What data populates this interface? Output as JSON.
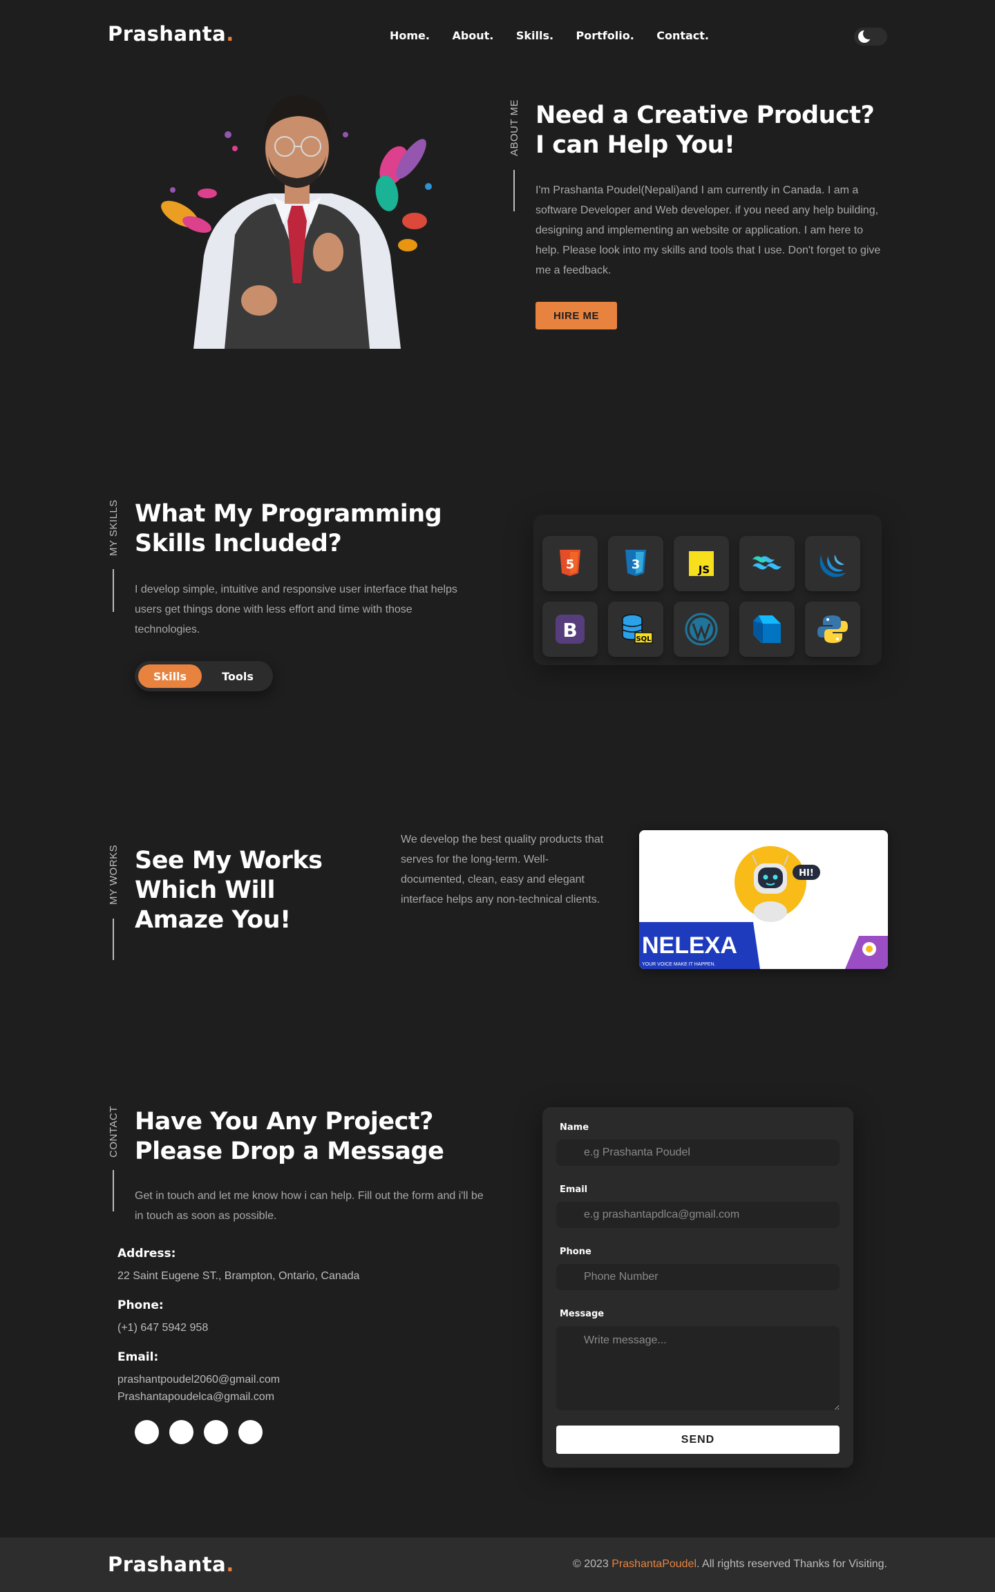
{
  "header": {
    "logo": "Prashanta",
    "logo_dot": ".",
    "nav": [
      "Home.",
      "About.",
      "Skills.",
      "Portfolio.",
      "Contact."
    ],
    "theme_icon": "moon-icon"
  },
  "about": {
    "label": "ABOUT ME",
    "title_line1": "Need a Creative Product?",
    "title_line2": "I can Help You!",
    "description": "I'm Prashanta Poudel(Nepali)and I am currently in Canada. I am a software Developer and Web developer. if you need any help building, designing and implementing an website or application. I am here to help. Please look into my skills and tools that I use. Don't forget to give me a feedback.",
    "hire_button": "HIRE ME",
    "portrait_icon": "portrait-photo"
  },
  "skills": {
    "label": "MY SKILLS",
    "title_line1": "What My Programming",
    "title_line2": "Skills Included?",
    "description": "I develop simple, intuitive and responsive user interface that helps users get things done with less effort and time with those technologies.",
    "tabs": [
      "Skills",
      "Tools"
    ],
    "active_tab": "Skills",
    "icons": [
      "html5-icon",
      "css3-icon",
      "javascript-icon",
      "tailwind-icon",
      "jquery-icon",
      "bootstrap-icon",
      "sql-icon",
      "wordpress-icon",
      "dart-icon",
      "python-icon"
    ],
    "icon_text": {
      "html": "5",
      "css": "3",
      "js": "JS",
      "bootstrap": "B",
      "sql": "SQL"
    }
  },
  "works": {
    "label": "MY WORKS",
    "title_line1": "See My Works",
    "title_line2": "Which Will",
    "title_line3": "Amaze You!",
    "description": "We develop the best quality products that serves for the long-term. Well-documented, clean, easy and elegant interface helps any non-technical clients.",
    "card": {
      "brand": "NELEXA",
      "tagline": "YOUR VOICE MAKE IT HAPPEN.",
      "bubble": "HI!"
    }
  },
  "contact": {
    "label": "CONTACT",
    "title_line1": "Have You Any Project?",
    "title_line2": "Please Drop a Message",
    "description": "Get in touch and let me know how i can help. Fill out the form and i'll be in touch as soon as possible.",
    "address_title": "Address:",
    "address": "22 Saint Eugene ST., Brampton, Ontario, Canada",
    "phone_title": "Phone:",
    "phone": "(+1) 647 5942 958",
    "email_title": "Email:",
    "email1": "prashantpoudel2060@gmail.com",
    "email2": "Prashantapoudelca@gmail.com",
    "form": {
      "name_label": "Name",
      "name_placeholder": "e.g Prashanta Poudel",
      "email_label": "Email",
      "email_placeholder": "e.g prashantapdlca@gmail.com",
      "phone_label": "Phone",
      "phone_placeholder": "Phone Number",
      "message_label": "Message",
      "message_placeholder": "Write message...",
      "send": "SEND"
    }
  },
  "footer": {
    "logo": "Prashanta",
    "logo_dot": ".",
    "copy_prefix": "© 2023 ",
    "copy_name": "PrashantaPoudel",
    "copy_suffix": ". All rights reserved Thanks for Visiting."
  },
  "colors": {
    "background": "#1e1e1e",
    "accent": "#e8833f",
    "footer": "#2d2d2d"
  }
}
